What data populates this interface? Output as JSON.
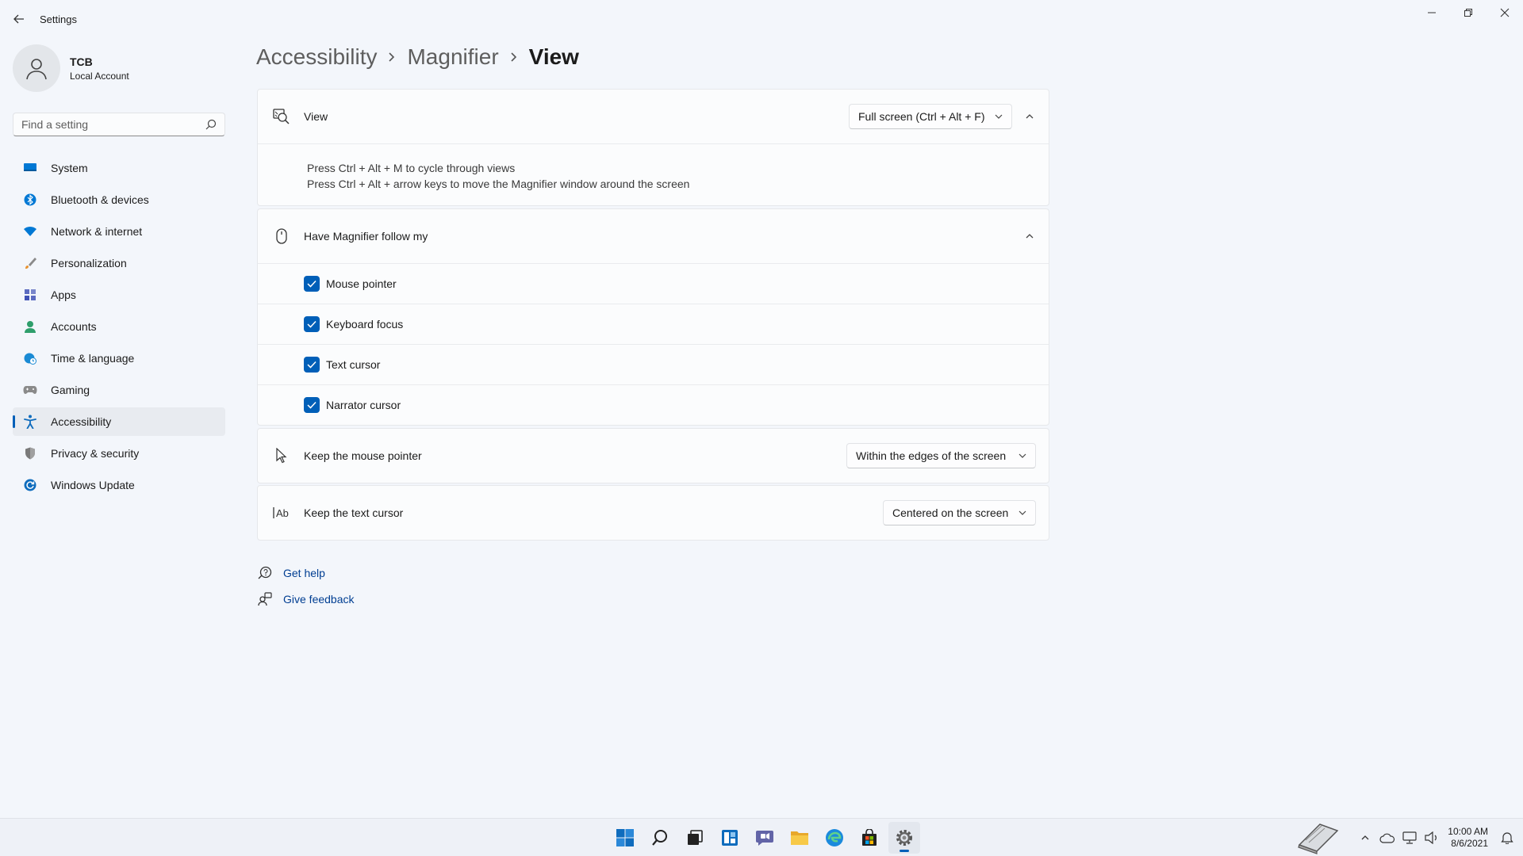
{
  "window": {
    "title": "Settings"
  },
  "profile": {
    "name": "TCB",
    "account_type": "Local Account"
  },
  "search": {
    "placeholder": "Find a setting"
  },
  "sidebar": {
    "items": [
      {
        "label": "System",
        "icon": "monitor-icon",
        "selected": false
      },
      {
        "label": "Bluetooth & devices",
        "icon": "bluetooth-icon",
        "selected": false
      },
      {
        "label": "Network & internet",
        "icon": "wifi-icon",
        "selected": false
      },
      {
        "label": "Personalization",
        "icon": "brush-icon",
        "selected": false
      },
      {
        "label": "Apps",
        "icon": "apps-icon",
        "selected": false
      },
      {
        "label": "Accounts",
        "icon": "person-icon",
        "selected": false
      },
      {
        "label": "Time & language",
        "icon": "globe-clock-icon",
        "selected": false
      },
      {
        "label": "Gaming",
        "icon": "gamepad-icon",
        "selected": false
      },
      {
        "label": "Accessibility",
        "icon": "accessibility-icon",
        "selected": true
      },
      {
        "label": "Privacy & security",
        "icon": "shield-icon",
        "selected": false
      },
      {
        "label": "Windows Update",
        "icon": "update-icon",
        "selected": false
      }
    ]
  },
  "breadcrumb": {
    "items": [
      "Accessibility",
      "Magnifier",
      "View"
    ]
  },
  "view_card": {
    "title": "View",
    "dropdown_value": "Full screen (Ctrl + Alt + F)",
    "hint_line1": "Press Ctrl + Alt + M to cycle through views",
    "hint_line2": "Press Ctrl + Alt + arrow keys to move the Magnifier window around the screen"
  },
  "follow_card": {
    "title": "Have Magnifier follow my",
    "options": [
      {
        "label": "Mouse pointer",
        "checked": true
      },
      {
        "label": "Keyboard focus",
        "checked": true
      },
      {
        "label": "Text cursor",
        "checked": true
      },
      {
        "label": "Narrator cursor",
        "checked": true
      }
    ]
  },
  "mouse_card": {
    "title": "Keep the mouse pointer",
    "dropdown_value": "Within the edges of the screen"
  },
  "text_card": {
    "title": "Keep the text cursor",
    "dropdown_value": "Centered on the screen"
  },
  "links": {
    "get_help": "Get help",
    "give_feedback": "Give feedback"
  },
  "taskbar": {
    "apps": [
      "windows-start-icon",
      "search-icon",
      "task-view-icon",
      "widgets-icon",
      "chat-icon",
      "file-explorer-icon",
      "edge-icon",
      "store-icon",
      "settings-icon"
    ],
    "time": "10:00 AM",
    "date": "8/6/2021"
  },
  "colors": {
    "accent": "#005fb8",
    "link": "#003e92",
    "background": "#f3f6fb"
  }
}
